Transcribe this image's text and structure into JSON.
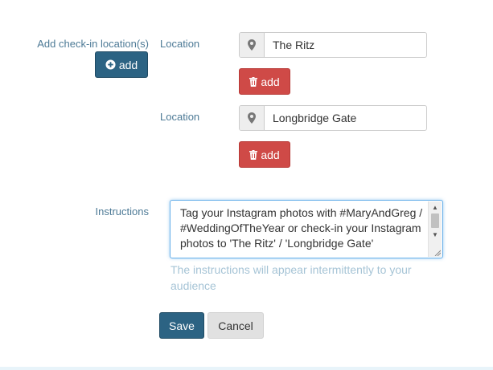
{
  "checkin": {
    "section_label": "Add check-in location(s)",
    "add_button_label": "add",
    "locations": [
      {
        "label": "Location",
        "value": "The Ritz",
        "remove_label": "add"
      },
      {
        "label": "Location",
        "value": "Longbridge Gate",
        "remove_label": "add"
      }
    ]
  },
  "instructions": {
    "label": "Instructions",
    "value": "Tag your Instagram photos with #MaryAndGreg / #WeddingOfTheYear or check-in your Instagram photos to 'The Ritz' / 'Longbridge Gate'",
    "help_text": "The instructions will appear intermittently to your audience"
  },
  "actions": {
    "save_label": "Save",
    "cancel_label": "Cancel"
  },
  "icons": {
    "add": "plus-circle-icon",
    "remove": "trash-icon",
    "location": "map-marker-icon"
  },
  "colors": {
    "primary": "#2c6383",
    "danger": "#cf4a47",
    "label": "#4d7a96",
    "help": "#a6c4d6",
    "focus_border": "#66afe9"
  }
}
